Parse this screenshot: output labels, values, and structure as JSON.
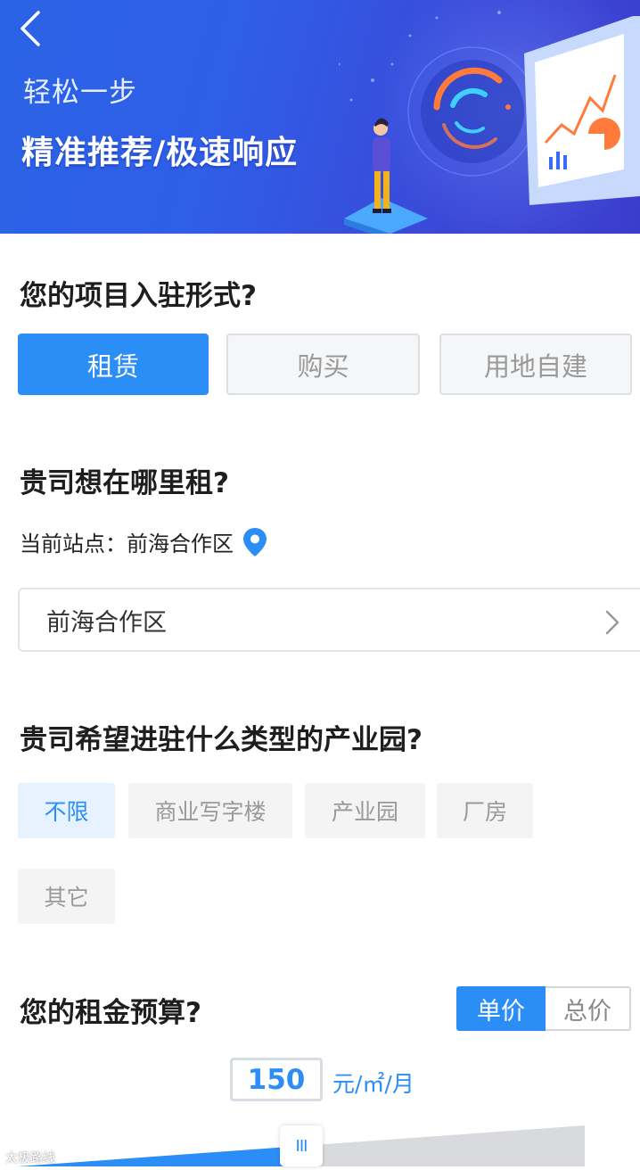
{
  "banner": {
    "subtitle": "轻松一步",
    "title": "精准推荐/极速响应"
  },
  "q1": {
    "title": "您的项目入驻形式?",
    "options": [
      "租赁",
      "购买",
      "用地自建"
    ],
    "selected": "租赁"
  },
  "q2": {
    "title": "贵司想在哪里租?",
    "station_label": "当前站点：前海合作区",
    "select_value": "前海合作区"
  },
  "q3": {
    "title": "贵司希望进驻什么类型的产业园?",
    "tags": [
      "不限",
      "商业写字楼",
      "产业园",
      "厂房",
      "其它"
    ],
    "selected": "不限"
  },
  "q4": {
    "title": "您的租金预算?",
    "toggle": [
      "单价",
      "总价"
    ],
    "toggle_selected": "单价",
    "budget_value": "150",
    "unit": "元/㎡/月",
    "slider_handle": "III"
  },
  "watermark": "太极路线",
  "colors": {
    "accent": "#2b8ef7",
    "banner": "#2f5ee8"
  }
}
